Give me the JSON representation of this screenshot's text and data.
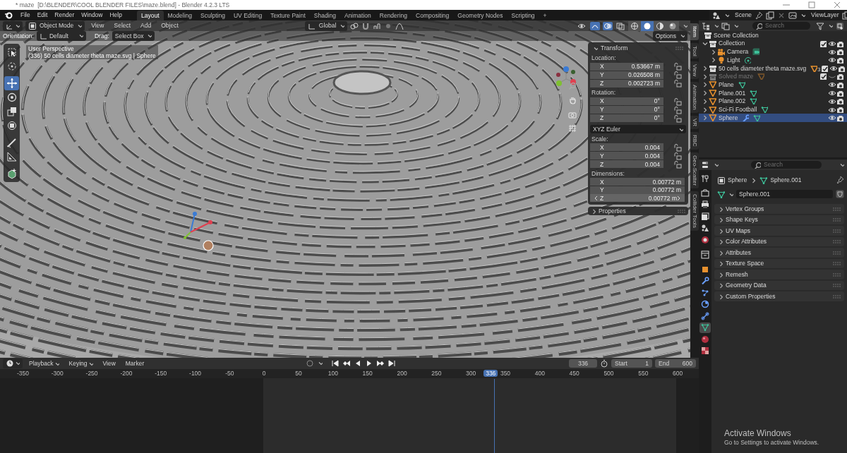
{
  "window": {
    "title": "* maze  [D:\\BLENDER\\COOL BLENDER FILES\\maze.blend] - Blender 4.2.3 LTS"
  },
  "menu": [
    "File",
    "Edit",
    "Render",
    "Window",
    "Help"
  ],
  "workspaces": [
    {
      "label": "Layout",
      "selected": true
    },
    {
      "label": "Modeling",
      "selected": false
    },
    {
      "label": "Sculpting",
      "selected": false
    },
    {
      "label": "UV Editing",
      "selected": false
    },
    {
      "label": "Texture Paint",
      "selected": false
    },
    {
      "label": "Shading",
      "selected": false
    },
    {
      "label": "Animation",
      "selected": false
    },
    {
      "label": "Rendering",
      "selected": false
    },
    {
      "label": "Compositing",
      "selected": false
    },
    {
      "label": "Geometry Nodes",
      "selected": false
    },
    {
      "label": "Scripting",
      "selected": false
    }
  ],
  "add_workspace": "+",
  "scene": "Scene",
  "view_layer": "ViewLayer",
  "viewport": {
    "mode": "Object Mode",
    "menus": [
      "View",
      "Select",
      "Add",
      "Object"
    ],
    "orientation": "Global",
    "shading": [
      {
        "kind": "wireframe",
        "selected": false
      },
      {
        "kind": "solid",
        "selected": true
      },
      {
        "kind": "material",
        "selected": false
      },
      {
        "kind": "rendered",
        "selected": false
      }
    ],
    "tool_settings": {
      "orientation_label": "Orientation:",
      "orientation": "Default",
      "drag_label": "Drag:",
      "drag": "Select Box"
    },
    "options": "Options",
    "info": [
      "User Perspective",
      "(336) 50 cells diameter theta maze.svg | Sphere"
    ],
    "tools": [
      {
        "kind": "select",
        "selected": false
      },
      {
        "kind": "cursor",
        "selected": false
      },
      {
        "kind": "move",
        "selected": true
      },
      {
        "kind": "rotate",
        "selected": false
      },
      {
        "kind": "scale",
        "selected": false
      },
      {
        "kind": "transform",
        "selected": false
      },
      {
        "kind": "annotate",
        "selected": false
      },
      {
        "kind": "measure",
        "selected": false
      },
      {
        "kind": "add",
        "selected": false
      }
    ]
  },
  "n_panel": {
    "title": "Transform",
    "groups": [
      {
        "label": "Location:",
        "rows": [
          {
            "axis": "X",
            "value": "0.53667 m",
            "locked": false
          },
          {
            "axis": "Y",
            "value": "0.026508 m",
            "locked": false
          },
          {
            "axis": "Z",
            "value": "0.002723 m",
            "locked": false
          }
        ]
      },
      {
        "label": "Rotation:",
        "rows": [
          {
            "axis": "X",
            "value": "0°",
            "locked": false
          },
          {
            "axis": "Y",
            "value": "0°",
            "locked": false
          },
          {
            "axis": "Z",
            "value": "0°",
            "locked": false
          }
        ],
        "dropdown": "XYZ Euler"
      },
      {
        "label": "Scale:",
        "rows": [
          {
            "axis": "X",
            "value": "0.004",
            "locked": false
          },
          {
            "axis": "Y",
            "value": "0.004",
            "locked": false
          },
          {
            "axis": "Z",
            "value": "0.004",
            "locked": false
          }
        ]
      },
      {
        "label": "Dimensions:",
        "rows": [
          {
            "axis": "X",
            "value": "0.00772 m",
            "hovered": false
          },
          {
            "axis": "Y",
            "value": "0.00772 m",
            "hovered": false
          },
          {
            "axis": "Z",
            "value": "0.00772 m",
            "hovered": true
          }
        ]
      }
    ],
    "collapsed_panel": "Properties"
  },
  "sidebar_tabs": [
    {
      "label": "Item",
      "selected": true
    },
    {
      "label": "Tool",
      "selected": false
    },
    {
      "label": "View",
      "selected": false
    },
    {
      "label": "Animation",
      "selected": false
    },
    {
      "label": "VR",
      "selected": false
    },
    {
      "label": "RBC",
      "selected": false
    },
    {
      "label": "Geo-Scatter",
      "selected": false
    },
    {
      "label": "Collider Tools",
      "selected": false
    }
  ],
  "outliner": {
    "search_placeholder": "Search",
    "tree": [
      {
        "label": "Scene Collection",
        "kind": "scene_collection",
        "selected": false,
        "disabled": false,
        "children": [
          {
            "label": "Collection",
            "kind": "collection",
            "expanded": true,
            "selected": false,
            "disabled": false,
            "included": true,
            "visible": true,
            "children": [
              {
                "label": "Camera",
                "kind": "camera",
                "expanded": false,
                "selected": false,
                "disabled": false,
                "visible": true,
                "data_icons": [
                  {
                    "kind": "camera"
                  }
                ]
              },
              {
                "label": "Light",
                "kind": "light",
                "expanded": false,
                "selected": false,
                "disabled": false,
                "visible": true,
                "data_icons": [
                  {
                    "kind": "light"
                  }
                ]
              }
            ]
          },
          {
            "label": "50 cells diameter theta maze.svg",
            "kind": "collection",
            "expanded": false,
            "selected": false,
            "disabled": false,
            "included": true,
            "visible": true,
            "data_icons": [
              {
                "kind": "mesh_object"
              }
            ],
            "count": "3"
          },
          {
            "label": "Solved maze",
            "kind": "collection",
            "expanded": false,
            "selected": false,
            "disabled": true,
            "included": true,
            "visible": false,
            "data_icons": [
              {
                "kind": "mesh_object"
              }
            ]
          },
          {
            "label": "Plane",
            "kind": "mesh",
            "expanded": false,
            "selected": false,
            "disabled": false,
            "visible": true,
            "data_icons": [
              {
                "kind": "mesh"
              }
            ]
          },
          {
            "label": "Plane.001",
            "kind": "mesh",
            "expanded": false,
            "selected": false,
            "disabled": false,
            "visible": true,
            "data_icons": [
              {
                "kind": "mesh"
              }
            ]
          },
          {
            "label": "Plane.002",
            "kind": "mesh",
            "expanded": false,
            "selected": false,
            "disabled": false,
            "visible": true,
            "data_icons": [
              {
                "kind": "mesh"
              }
            ]
          },
          {
            "label": "Sci-Fi Football",
            "kind": "mesh",
            "expanded": false,
            "selected": false,
            "disabled": false,
            "visible": true,
            "data_icons": [
              {
                "kind": "mesh"
              }
            ]
          },
          {
            "label": "Sphere",
            "kind": "mesh",
            "expanded": false,
            "selected": true,
            "disabled": false,
            "visible": true,
            "data_icons": [
              {
                "kind": "modifier"
              },
              {
                "kind": "mesh"
              }
            ]
          }
        ]
      }
    ]
  },
  "properties": {
    "search_placeholder": "Search",
    "tabs": [
      {
        "kind": "tool",
        "selected": false
      },
      {
        "kind": "render",
        "selected": false
      },
      {
        "kind": "output",
        "selected": false
      },
      {
        "kind": "view_layer",
        "selected": false
      },
      {
        "kind": "scene",
        "selected": false
      },
      {
        "kind": "world",
        "selected": false
      },
      {
        "kind": "collection",
        "selected": false
      },
      {
        "kind": "object",
        "selected": false
      },
      {
        "kind": "modifiers",
        "selected": false
      },
      {
        "kind": "particles",
        "selected": false
      },
      {
        "kind": "physics",
        "selected": false
      },
      {
        "kind": "constraints",
        "selected": false
      },
      {
        "kind": "data",
        "selected": true
      },
      {
        "kind": "material",
        "selected": false
      },
      {
        "kind": "texture",
        "selected": false
      }
    ],
    "breadcrumb": [
      "Sphere",
      "Sphere.001"
    ],
    "datablock": "Sphere.001",
    "panels": [
      "Vertex Groups",
      "Shape Keys",
      "UV Maps",
      "Color Attributes",
      "Attributes",
      "Texture Space",
      "Remesh",
      "Geometry Data",
      "Custom Properties"
    ]
  },
  "timeline": {
    "menus": [
      {
        "label": "Playback",
        "dropdown": true
      },
      {
        "label": "Keying",
        "dropdown": true
      },
      {
        "label": "View",
        "dropdown": false
      },
      {
        "label": "Marker",
        "dropdown": false
      }
    ],
    "current_frame": "336",
    "start_label": "Start",
    "start": "1",
    "end_label": "End",
    "end": "600",
    "ticks": [
      "-350",
      "-300",
      "-250",
      "-200",
      "-150",
      "-100",
      "-50",
      "0",
      "50",
      "100",
      "150",
      "200",
      "250",
      "300",
      "350",
      "400",
      "450",
      "500",
      "550",
      "600"
    ],
    "playhead": "336"
  },
  "os_notice": {
    "title": "Activate Windows",
    "text": "Go to Settings to activate Windows."
  }
}
